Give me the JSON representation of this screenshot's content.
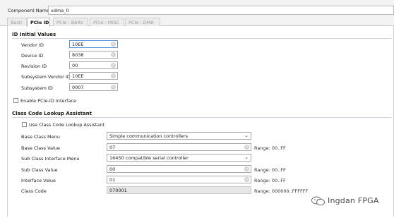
{
  "component": {
    "label": "Component Name",
    "value": "xdma_0"
  },
  "tabs": [
    {
      "label": "Basic"
    },
    {
      "label": "PCIe ID"
    },
    {
      "label": "PCIe : BARs"
    },
    {
      "label": "PCIe : MISC"
    },
    {
      "label": "PCIe : DMA"
    }
  ],
  "active_tab": "PCIe ID",
  "id_section": {
    "title": "ID Initial Values",
    "fields": [
      {
        "label": "Vendor ID",
        "value": "10EE"
      },
      {
        "label": "Device ID",
        "value": "8038"
      },
      {
        "label": "Revision ID",
        "value": "00"
      },
      {
        "label": "Subsystem Vendor ID",
        "value": "10EE"
      },
      {
        "label": "Subsystem ID",
        "value": "0007"
      }
    ],
    "enable_checkbox": {
      "label": "Enable PCIe-ID Interface",
      "checked": false
    }
  },
  "class_section": {
    "title": "Class Code Lookup Assistant",
    "use_checkbox": {
      "label": "Use Class Code Lookup Assistant",
      "checked": false
    },
    "rows": [
      {
        "label": "Base Class Menu",
        "value": "Simple communication controllers",
        "range": ""
      },
      {
        "label": "Base Class Value",
        "value": "07",
        "range": "Range: 00..FF"
      },
      {
        "label": "Sub Class Interface Menu",
        "value": "16450 compatible serial controller",
        "range": ""
      },
      {
        "label": "Sub Class Value",
        "value": "00",
        "range": "Range: 00..FF"
      },
      {
        "label": "Interface Value",
        "value": "01",
        "range": "Range: 00..FF"
      },
      {
        "label": "Class Code",
        "value": "070001",
        "range": "Range: 000000..FFFFFF"
      }
    ]
  },
  "watermark": {
    "text": "Ingdan FPGA",
    "icon": "wechat-icon"
  }
}
